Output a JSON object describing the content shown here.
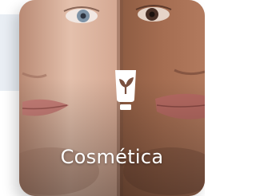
{
  "category_card": {
    "label": "Cosmética",
    "icon": "cream-tube-leaf-icon",
    "image": "two-faces-skin-photo"
  }
}
